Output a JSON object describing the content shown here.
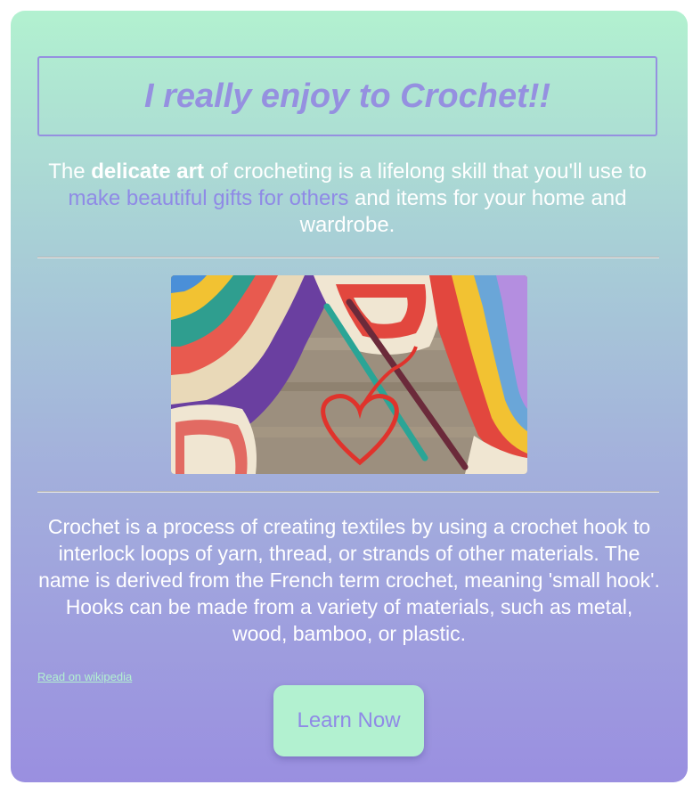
{
  "title": "I really enjoy to Crochet!!",
  "intro": {
    "part1": "The ",
    "bold": "delicate art",
    "part2": " of crocheting is a lifelong skill that you'll use to ",
    "accent": "make beautiful gifts for others",
    "part3": " and items for your home and wardrobe."
  },
  "image": {
    "icon": "crochet-photo"
  },
  "description": "Crochet is a process of creating textiles by using a crochet hook to interlock loops of yarn, thread, or strands of other materials. The name is derived from the French term crochet, meaning 'small hook'. Hooks can be made from a variety of materials, such as metal, wood, bamboo, or plastic.",
  "wiki_link": "Read on wikipedia",
  "cta_label": "Learn Now",
  "colors": {
    "accent": "#9590e0",
    "gradient_top": "#b2f1d0",
    "gradient_bottom": "#9a8fe0",
    "button_bg": "#b2f1d0"
  }
}
